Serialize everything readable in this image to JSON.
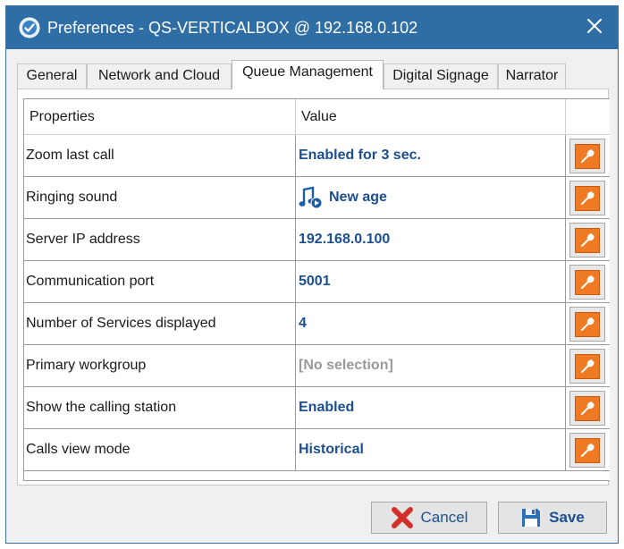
{
  "window": {
    "title": "Preferences - QS-VERTICALBOX @ 192.168.0.102"
  },
  "icons": {
    "app": "gear-check-icon",
    "close": "close-icon",
    "edit": "wrench-icon",
    "ringing": "music-note-icon",
    "cancel": "red-x-icon",
    "save": "floppy-disk-icon"
  },
  "colors": {
    "titlebar": "#2f6ea4",
    "value_text": "#1c4f8f",
    "muted_text": "#9a9a9a",
    "edit_button": "#f07a24",
    "cancel_icon": "#d4302a"
  },
  "tabs": [
    {
      "label": "General",
      "active": false
    },
    {
      "label": "Network and Cloud",
      "active": false
    },
    {
      "label": "Queue Management",
      "active": true
    },
    {
      "label": "Digital Signage",
      "active": false
    },
    {
      "label": "Narrator",
      "active": false
    }
  ],
  "grid": {
    "headers": {
      "property": "Properties",
      "value": "Value"
    },
    "rows": [
      {
        "property": "Zoom last call",
        "value": "Enabled for 3 sec."
      },
      {
        "property": "Ringing sound",
        "value": "New age"
      },
      {
        "property": "Server IP address",
        "value": "192.168.0.100"
      },
      {
        "property": "Communication port",
        "value": "5001"
      },
      {
        "property": "Number of Services displayed",
        "value": "4"
      },
      {
        "property": "Primary workgroup",
        "value": "[No selection]"
      },
      {
        "property": "Show the calling station",
        "value": "Enabled"
      },
      {
        "property": "Calls view mode",
        "value": "Historical"
      }
    ]
  },
  "buttons": {
    "cancel": "Cancel",
    "save": "Save"
  }
}
